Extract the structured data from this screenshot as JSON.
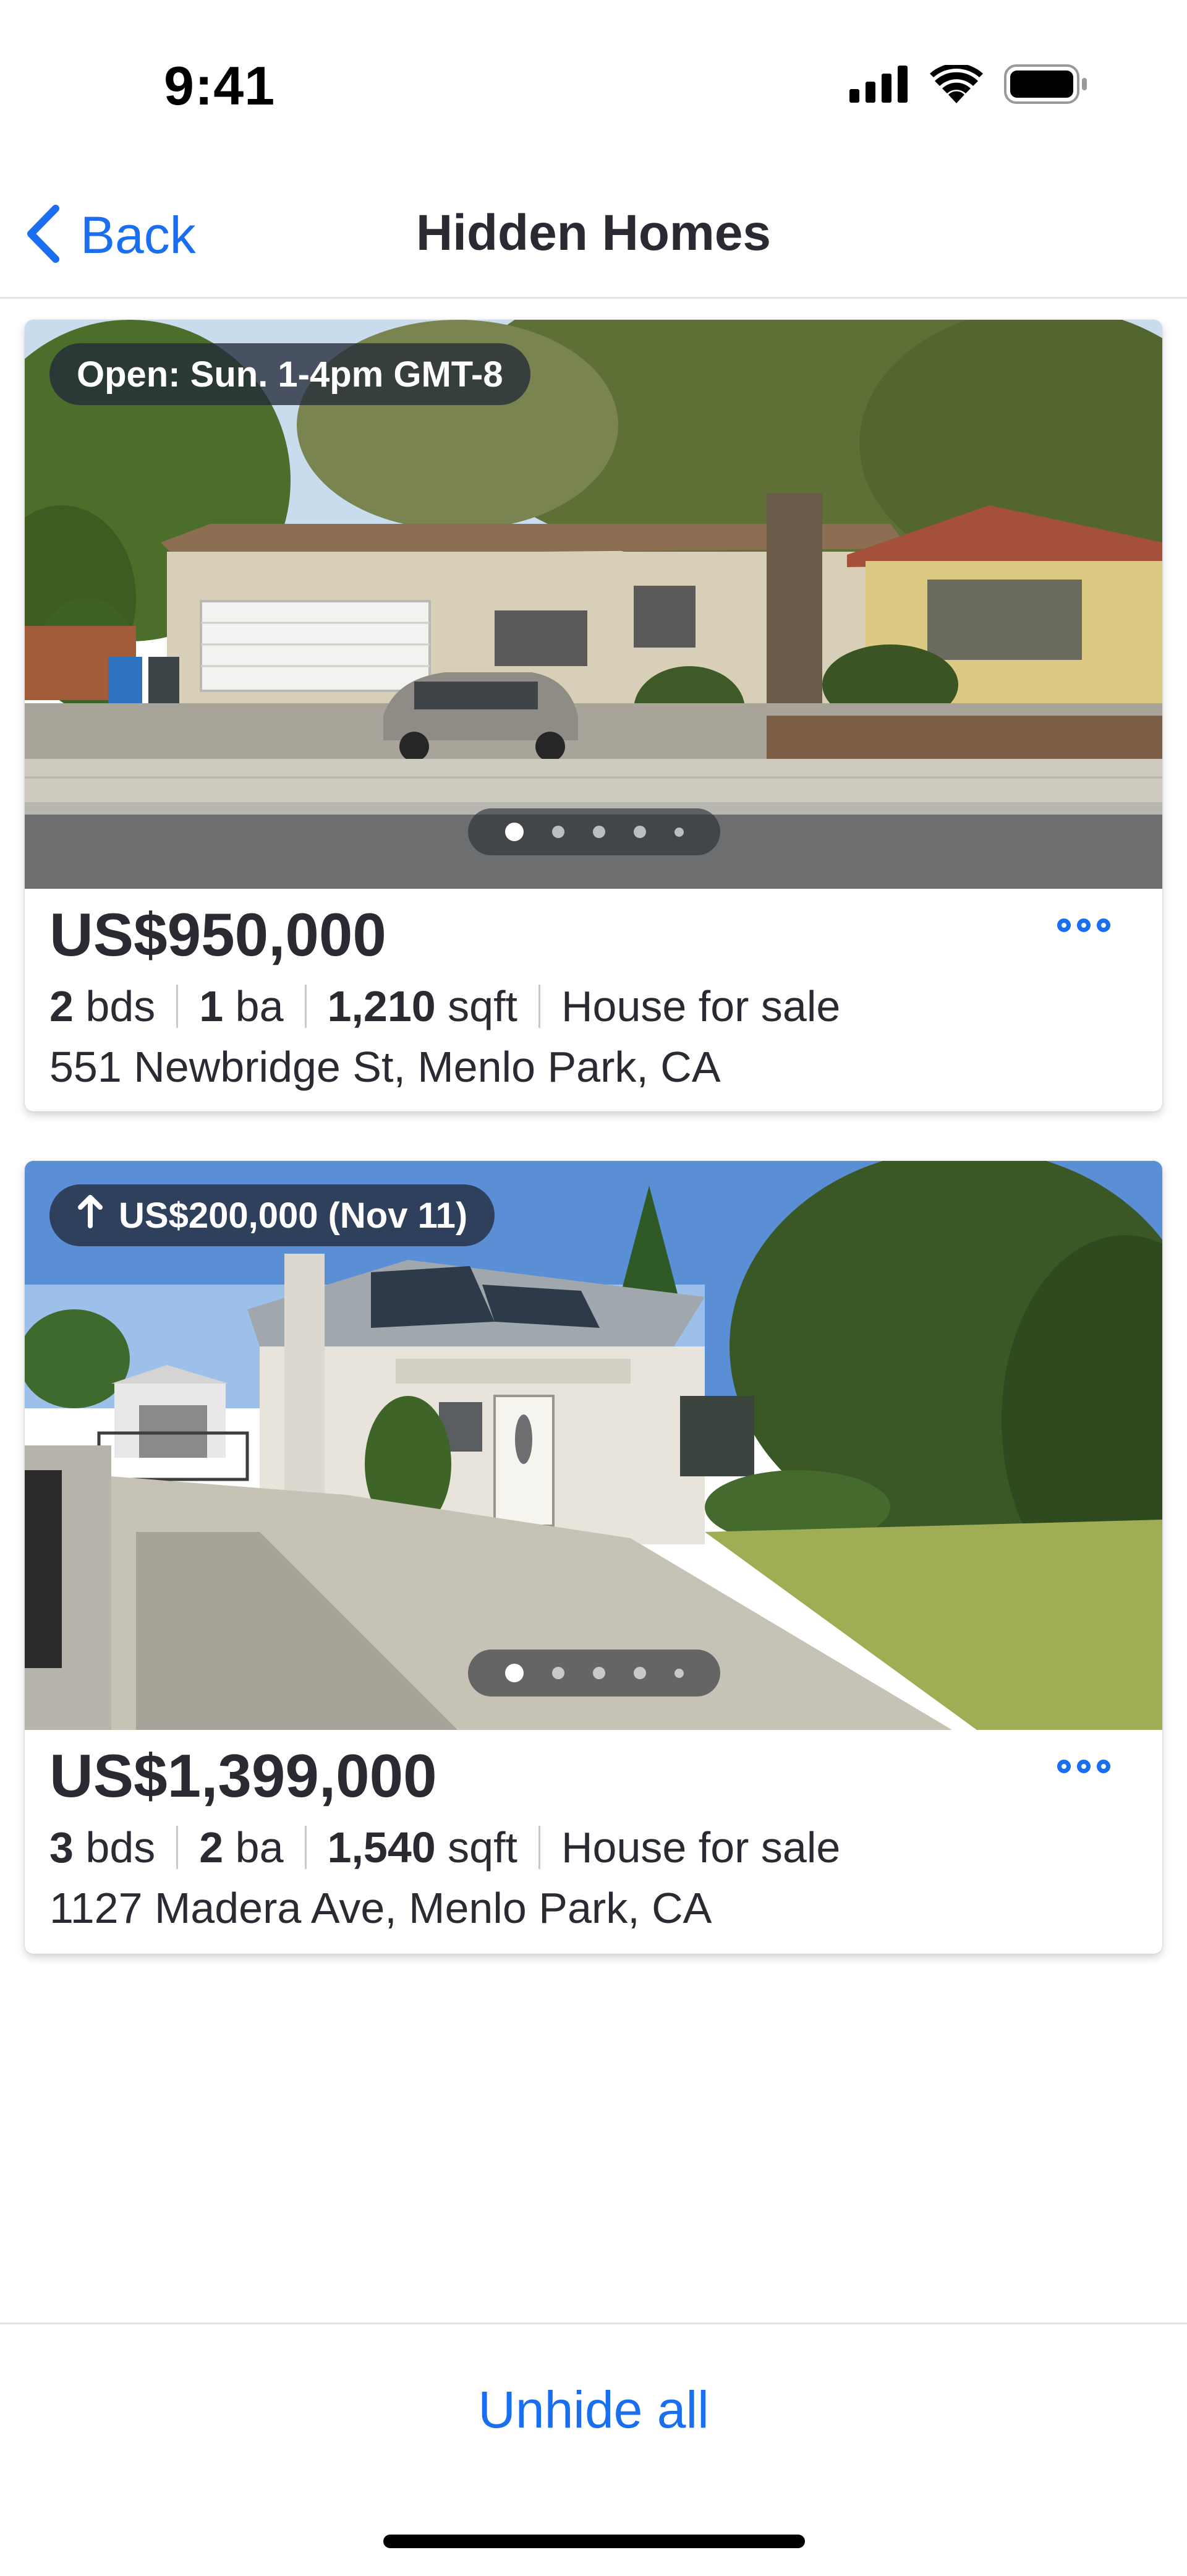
{
  "status_bar": {
    "time": "9:41",
    "icons": [
      "cellular-signal-icon",
      "wifi-icon",
      "battery-icon"
    ]
  },
  "nav": {
    "back_label": "Back",
    "title": "Hidden Homes"
  },
  "listings": [
    {
      "badge_text": "Open: Sun. 1-4pm GMT-8",
      "price": "US$950,000",
      "beds": "2",
      "beds_label": "bds",
      "baths": "1",
      "baths_label": "ba",
      "sqft": "1,210",
      "sqft_label": "sqft",
      "type": "House for sale",
      "address": "551 Newbridge St, Menlo Park, CA",
      "photo_count": 5,
      "active_photo": 1
    },
    {
      "badge_text": "US$200,000 (Nov 11)",
      "badge_icon": "arrow-up-icon",
      "price": "US$1,399,000",
      "beds": "3",
      "beds_label": "bds",
      "baths": "2",
      "baths_label": "ba",
      "sqft": "1,540",
      "sqft_label": "sqft",
      "type": "House for sale",
      "address": "1127 Madera Ave, Menlo Park, CA",
      "photo_count": 5,
      "active_photo": 1
    }
  ],
  "footer": {
    "unhide_all_label": "Unhide all"
  },
  "colors": {
    "accent": "#1a6ef0",
    "text": "#2a2a33",
    "badge_bg": "#222a3a"
  }
}
